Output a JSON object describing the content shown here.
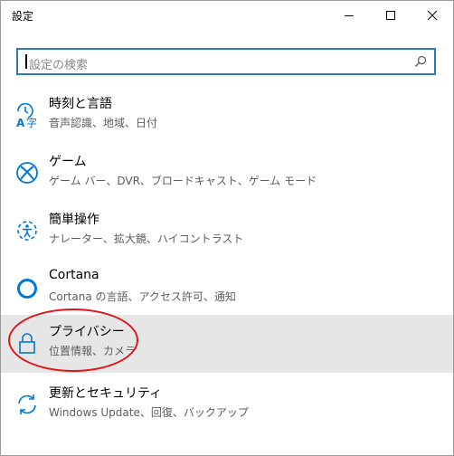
{
  "window": {
    "title": "設定",
    "controls": [
      "minimize-icon",
      "maximize-icon",
      "close-icon"
    ]
  },
  "search": {
    "placeholder": "設定の検索",
    "icon": "search-icon"
  },
  "settings_items": [
    {
      "label": "時刻と言語",
      "description": "音声認識、地域、日付",
      "icon": "time-language-icon"
    },
    {
      "label": "ゲーム",
      "description": "ゲーム バー、DVR、ブロードキャスト、ゲーム モード",
      "icon": "xbox-icon"
    },
    {
      "label": "簡単操作",
      "description": "ナレーター、拡大鏡、ハイコントラスト",
      "icon": "ease-of-access-icon"
    },
    {
      "label": "Cortana",
      "description": "Cortana の言語、アクセス許可、通知",
      "icon": "cortana-icon"
    },
    {
      "label": "プライバシー",
      "description": "位置情報、カメラ",
      "icon": "lock-icon",
      "selected": true
    },
    {
      "label": "更新とセキュリティ",
      "description": "Windows Update、回復、バックアップ",
      "icon": "update-icon"
    }
  ],
  "colors": {
    "accent": "#0078d7",
    "selected_background": "#e6e6e6",
    "annotation": "#e0161a"
  }
}
